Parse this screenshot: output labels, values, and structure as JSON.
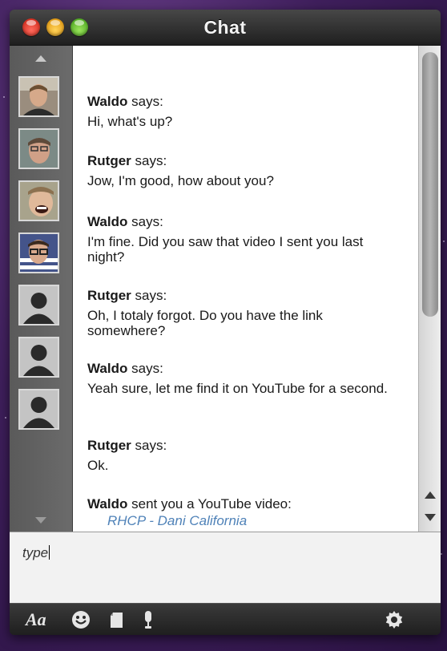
{
  "window": {
    "title": "Chat",
    "buttons": [
      "close",
      "minimize",
      "zoom"
    ]
  },
  "sidebar": {
    "avatars": [
      {
        "type": "photo",
        "icon": "person-photo-icon"
      },
      {
        "type": "photo",
        "icon": "person-photo-icon"
      },
      {
        "type": "photo",
        "icon": "person-photo-icon"
      },
      {
        "type": "photo",
        "icon": "person-photo-icon"
      },
      {
        "type": "placeholder",
        "icon": "default-avatar-icon"
      },
      {
        "type": "placeholder",
        "icon": "default-avatar-icon"
      },
      {
        "type": "placeholder",
        "icon": "default-avatar-icon"
      }
    ]
  },
  "messages": [
    {
      "sender": "Waldo",
      "verb": "says:",
      "text": "Hi, what's up?"
    },
    {
      "sender": "Rutger",
      "verb": "says:",
      "text": "Jow, I'm good, how about you?"
    },
    {
      "sender": "Waldo",
      "verb": "says:",
      "text": "I'm fine. Did you saw that video I sent you last night?"
    },
    {
      "sender": "Rutger",
      "verb": "says:",
      "text": "Oh, I totaly forgot. Do you have the link somewhere?"
    },
    {
      "sender": "Waldo",
      "verb": "says:",
      "text": "Yeah sure, let me find it on YouTube for a second."
    },
    {
      "sender": "Rutger",
      "verb": "says:",
      "text": "Ok."
    },
    {
      "sender": "Waldo",
      "verb": "sent you a YouTube video:",
      "link": "RHCP - Dani California"
    }
  ],
  "input": {
    "value": "type"
  },
  "toolbar": {
    "font_label": "Aa",
    "icons": [
      "smiley-icon",
      "file-icon",
      "microphone-icon",
      "settings-gear-icon"
    ]
  },
  "colors": {
    "link": "#4f82b8",
    "titlebar": "#2a2a2a",
    "sidebar": "#666666"
  }
}
